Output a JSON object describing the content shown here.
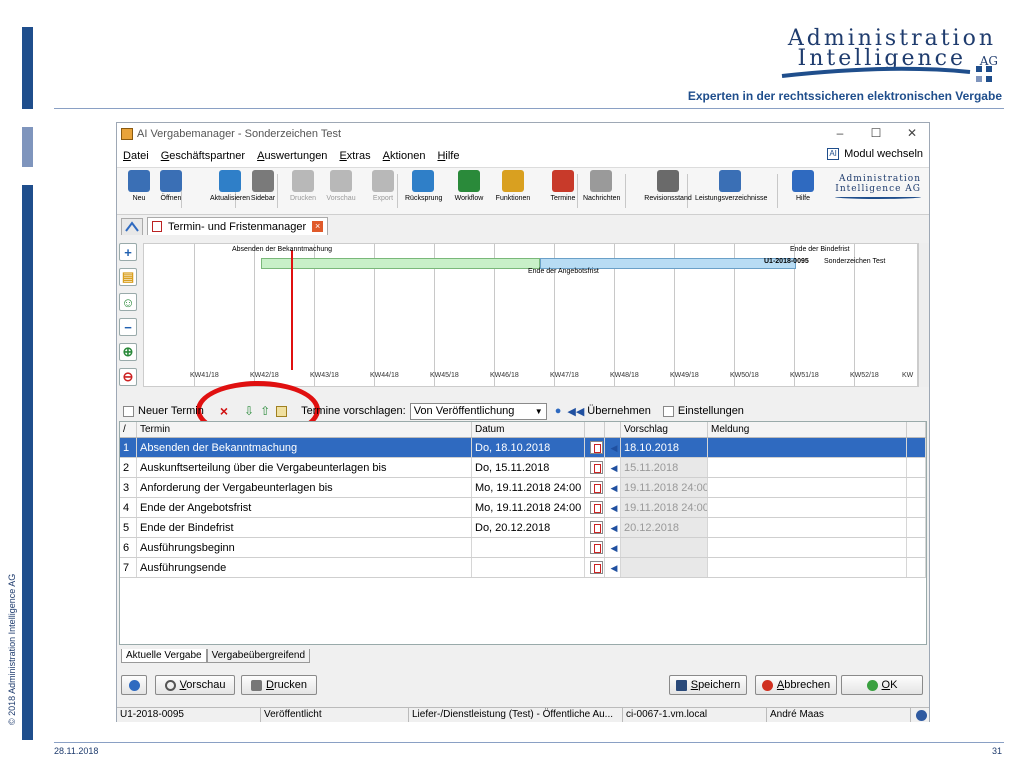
{
  "slide": {
    "logo_line1": "Administration",
    "logo_line2": "Intelligence",
    "logo_ag": "AG",
    "tagline": "Experten in der rechtssicheren elektronischen Vergabe",
    "copyright": "© 2018 Administration Intelligence AG",
    "date": "28.11.2018",
    "page": "31",
    "brand_color": "#1f4e8c"
  },
  "window": {
    "title": "AI Vergabemanager - Sonderzeichen Test",
    "controls": {
      "minimize": "–",
      "maximize": "☐",
      "close": "✕"
    }
  },
  "menu": {
    "items": [
      "Datei",
      "Geschäftspartner",
      "Auswertungen",
      "Extras",
      "Aktionen",
      "Hilfe"
    ],
    "modul": "Modul wechseln"
  },
  "toolbar": {
    "buttons": [
      {
        "label": "Neu",
        "icon": "new-db-icon",
        "color": "#3a6fb5"
      },
      {
        "label": "Öffnen",
        "icon": "open-db-icon",
        "color": "#3a6fb5"
      },
      {
        "label": "Aktualisieren",
        "icon": "refresh-icon",
        "color": "#2f7fc8"
      },
      {
        "label": "Sidebar",
        "icon": "sidebar-icon",
        "color": "#7a7a7a"
      },
      {
        "label": "Drucken",
        "icon": "print-icon",
        "color": "#b8b8b8"
      },
      {
        "label": "Vorschau",
        "icon": "preview-icon",
        "color": "#b8b8b8"
      },
      {
        "label": "Export",
        "icon": "export-icon",
        "color": "#b8b8b8"
      },
      {
        "label": "Rücksprung",
        "icon": "back-icon",
        "color": "#2f7fc8"
      },
      {
        "label": "Workflow",
        "icon": "workflow-icon",
        "color": "#2a8a3a"
      },
      {
        "label": "Funktionen",
        "icon": "functions-icon",
        "color": "#d9a020"
      },
      {
        "label": "Termine",
        "icon": "calendar-icon",
        "color": "#c83a2a"
      },
      {
        "label": "Nachrichten",
        "icon": "mail-icon",
        "color": "#9a9a9a"
      },
      {
        "label": "Revisionsstand",
        "icon": "revision-icon",
        "color": "#6a6a6a"
      },
      {
        "label": "Leistungsverzeichnisse",
        "icon": "table-icon",
        "color": "#3a6fb5"
      },
      {
        "label": "Hilfe",
        "icon": "help-icon",
        "color": "#2f6ac0"
      }
    ],
    "logo_line1": "Administration",
    "logo_line2": "Intelligence AG"
  },
  "tabs": {
    "home_icon": "home-icon",
    "active": "Termin- und Fristenmanager"
  },
  "gantt": {
    "kw_labels": [
      "KW41/18",
      "KW42/18",
      "KW43/18",
      "KW44/18",
      "KW45/18",
      "KW46/18",
      "KW47/18",
      "KW48/18",
      "KW49/18",
      "KW50/18",
      "KW51/18",
      "KW52/18",
      "KW"
    ],
    "label_publication": "Absenden der Bekanntmachung",
    "label_binding": "Ende der Bindefrist",
    "label_offer": "Ende der Angebotsfrist",
    "bar_project": "U1-2018-0095",
    "bar_project_name": "Sonderzeichen Test",
    "side_buttons": [
      "add-icon",
      "add-folder-icon",
      "add-person-icon",
      "remove-icon",
      "zoom-in-icon",
      "zoom-out-icon"
    ]
  },
  "termin_toolbar": {
    "new_label": "Neuer Termin",
    "delete_icon": "×",
    "propose_label": "Termine vorschlagen:",
    "propose_value": "Von Veröffentlichung",
    "apply_label": "Übernehmen",
    "settings_label": "Einstellungen"
  },
  "table": {
    "headers": {
      "num": "/",
      "termin": "Termin",
      "datum": "Datum",
      "b1": "",
      "b2": "",
      "vorschlag": "Vorschlag",
      "meldung": "Meldung"
    },
    "rows": [
      {
        "n": "1",
        "termin": "Absenden der Bekanntmachung",
        "datum": "Do, 18.10.2018",
        "vorschlag": "18.10.2018",
        "meldung": ""
      },
      {
        "n": "2",
        "termin": "Auskunftserteilung über die Vergabeunterlagen bis",
        "datum": "Do, 15.11.2018",
        "vorschlag": "15.11.2018",
        "meldung": ""
      },
      {
        "n": "3",
        "termin": "Anforderung der Vergabeunterlagen bis",
        "datum": "Mo, 19.11.2018 24:00",
        "vorschlag": "19.11.2018 24:00",
        "meldung": ""
      },
      {
        "n": "4",
        "termin": "Ende der Angebotsfrist",
        "datum": "Mo, 19.11.2018 24:00",
        "vorschlag": "19.11.2018 24:00",
        "meldung": ""
      },
      {
        "n": "5",
        "termin": "Ende der Bindefrist",
        "datum": "Do, 20.12.2018",
        "vorschlag": "20.12.2018",
        "meldung": ""
      },
      {
        "n": "6",
        "termin": "Ausführungsbeginn",
        "datum": "",
        "vorschlag": "",
        "meldung": ""
      },
      {
        "n": "7",
        "termin": "Ausführungsende",
        "datum": "",
        "vorschlag": "",
        "meldung": ""
      }
    ]
  },
  "bottom_tabs": [
    "Aktuelle Vergabe",
    "Vergabeübergreifend"
  ],
  "buttons": {
    "vorschau": "Vorschau",
    "drucken": "Drucken",
    "speichern": "Speichern",
    "abbrechen": "Abbrechen",
    "ok": "OK"
  },
  "status": {
    "id": "U1-2018-0095",
    "state": "Veröffentlicht",
    "type": "Liefer-/Dienstleistung (Test) - Öffentliche Au...",
    "server": "ci-0067-1.vm.local",
    "user": "André Maas"
  }
}
